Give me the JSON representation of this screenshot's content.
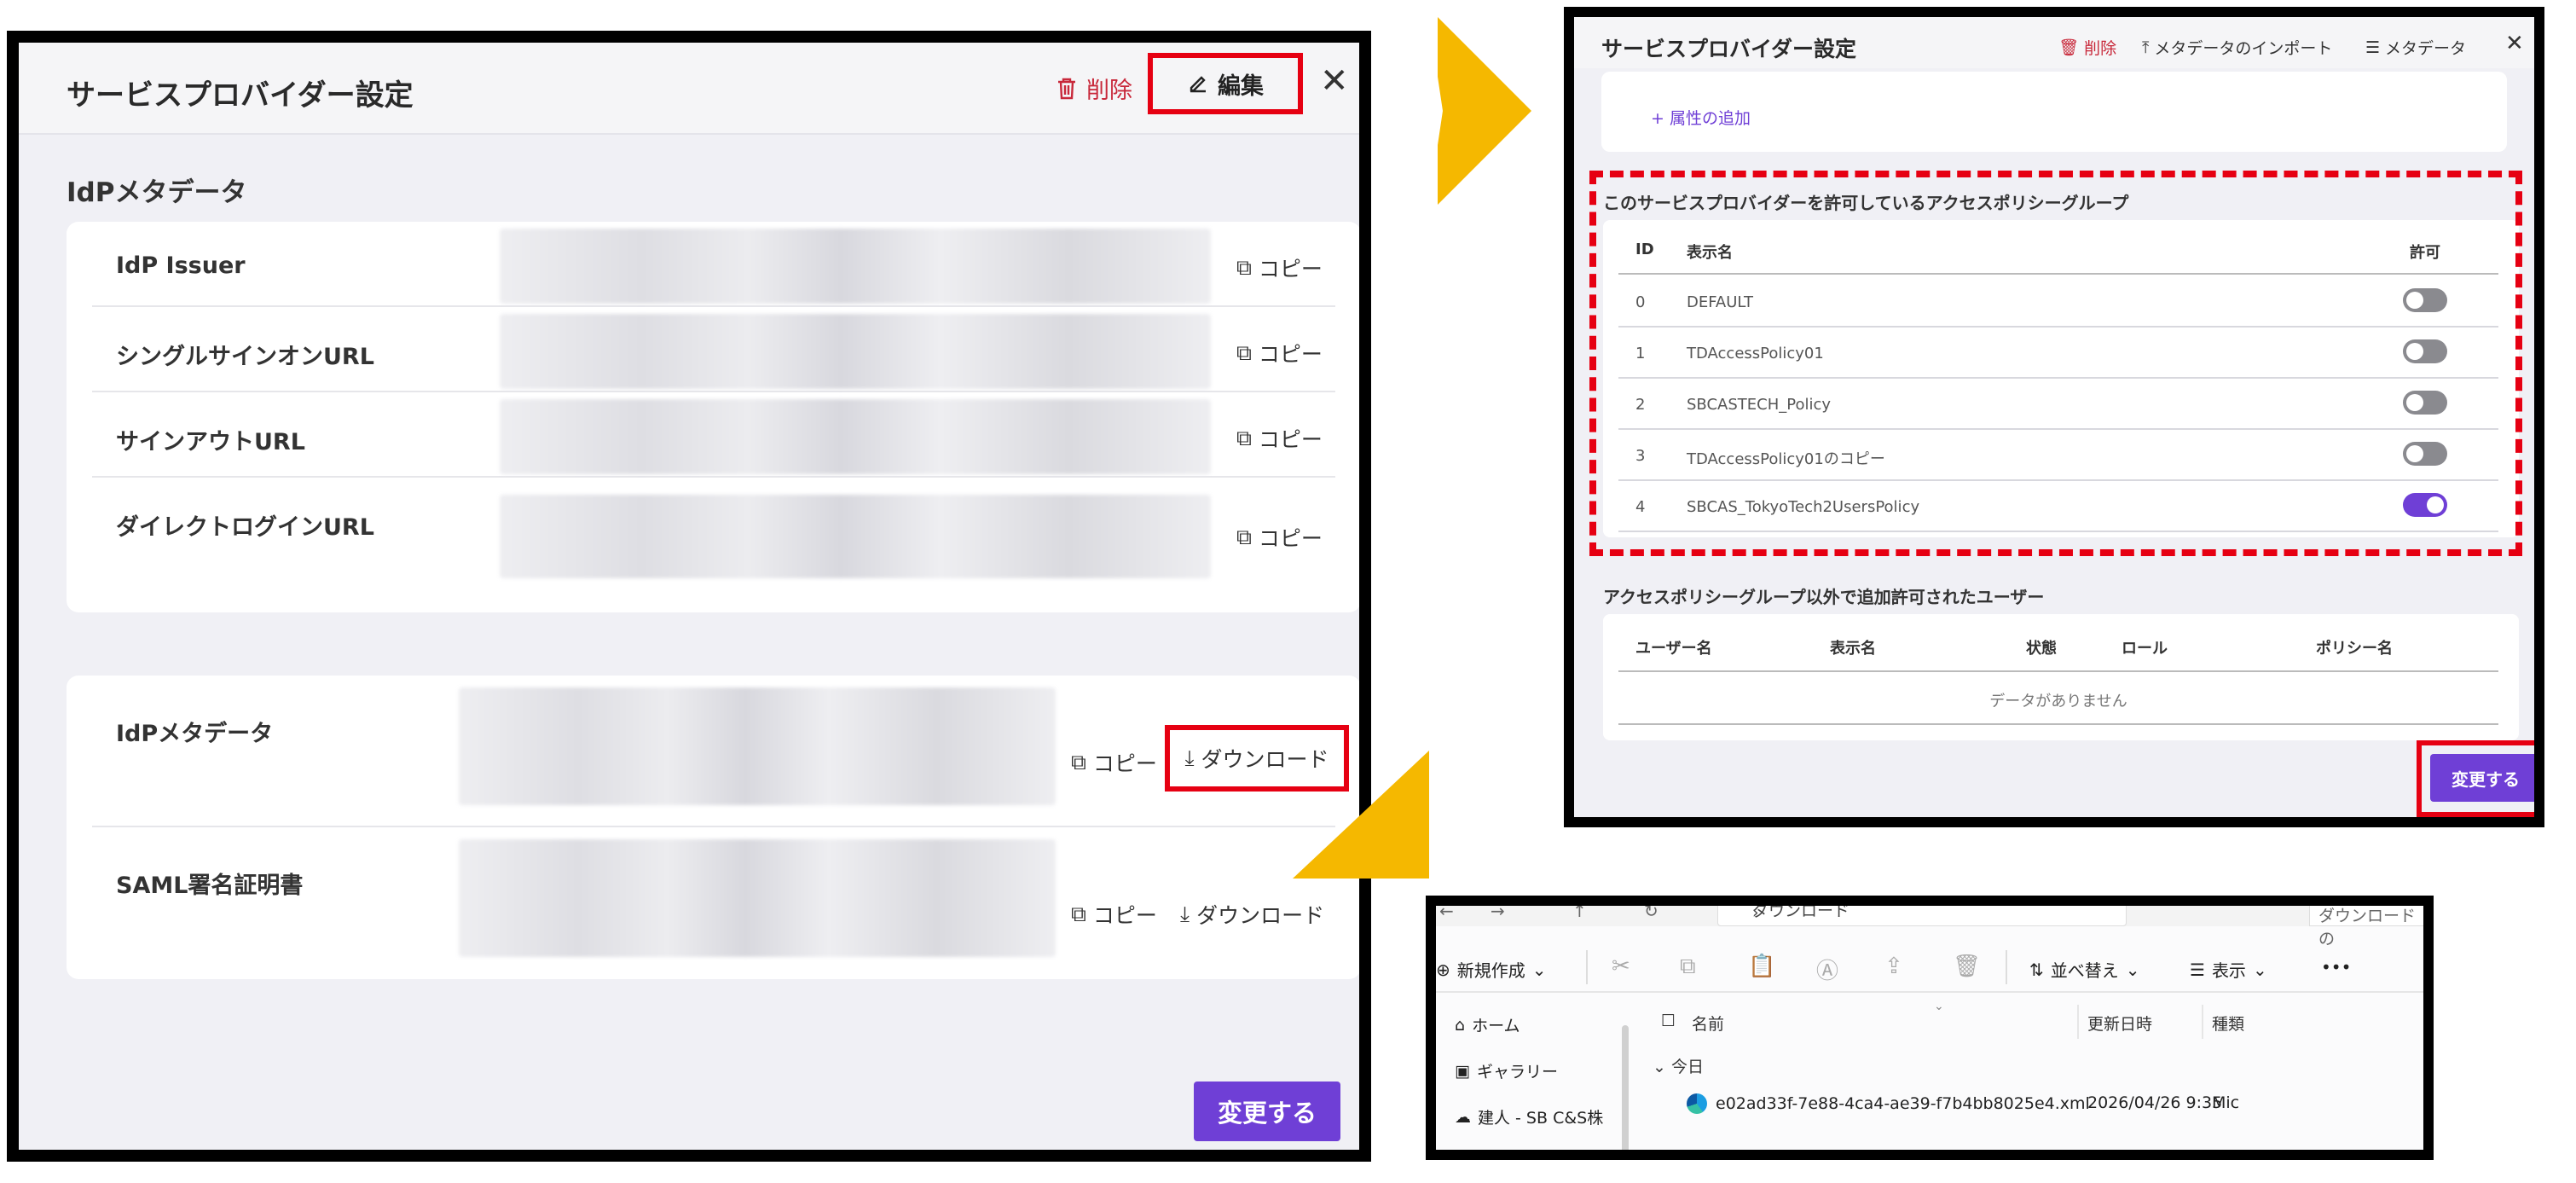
{
  "panel1": {
    "title": "サービスプロバイダー設定",
    "delete_label": "削除",
    "edit_label": "編集",
    "section_title": "IdPメタデータ",
    "info_rows": [
      {
        "label": "IdP Issuer",
        "copy": "コピー"
      },
      {
        "label": "シングルサインオンURL",
        "copy": "コピー"
      },
      {
        "label": "サインアウトURL",
        "copy": "コピー"
      },
      {
        "label": "ダイレクトログインURL",
        "copy": "コピー"
      }
    ],
    "file_rows": [
      {
        "label": "IdPメタデータ",
        "copy": "コピー",
        "download": "ダウンロード"
      },
      {
        "label": "SAML署名証明書",
        "copy": "コピー",
        "download": "ダウンロード"
      }
    ],
    "save_label": "変更する"
  },
  "panel2": {
    "title": "サービスプロバイダー設定",
    "delete_label": "削除",
    "import_label": "メタデータのインポート",
    "metadata_label": "メタデータ",
    "add_attribute": "属性の追加",
    "policy_section": "このサービスプロバイダーを許可しているアクセスポリシーグループ",
    "policy_headers": {
      "id": "ID",
      "name": "表示名",
      "allow": "許可"
    },
    "policies": [
      {
        "id": "0",
        "name": "DEFAULT",
        "allowed": false
      },
      {
        "id": "1",
        "name": "TDAccessPolicy01",
        "allowed": false
      },
      {
        "id": "2",
        "name": "SBCASTECH_Policy",
        "allowed": false
      },
      {
        "id": "3",
        "name": "TDAccessPolicy01のコピー",
        "allowed": false
      },
      {
        "id": "4",
        "name": "SBCAS_TokyoTech2UsersPolicy",
        "allowed": true
      }
    ],
    "users_section": "アクセスポリシーグループ以外で追加許可されたユーザー",
    "user_headers": {
      "username": "ユーザー名",
      "display_name": "表示名",
      "status": "状態",
      "role": "ロール",
      "policy": "ポリシー名"
    },
    "no_data": "データがありません",
    "save_label": "変更する"
  },
  "explorer": {
    "path": "ダウンロード",
    "search": "ダウンロードの",
    "new_label": "新規作成",
    "sort_label": "並べ替え",
    "view_label": "表示",
    "more_label": "•••",
    "sidebar": [
      {
        "label": "ホーム",
        "icon": "home-icon"
      },
      {
        "label": "ギャラリー",
        "icon": "gallery-icon"
      },
      {
        "label": "建人 - SB C&S株",
        "icon": "onedrive-icon"
      }
    ],
    "columns": {
      "name": "名前",
      "date": "更新日時",
      "type": "種類"
    },
    "group": "今日",
    "file": {
      "name": "e02ad33f-7e88-4ca4-ae39-f7b4bb8025e4.xml",
      "date": "2026/04/26 9:35",
      "type": "Mic"
    }
  },
  "colors": {
    "accent": "#6f3fd6",
    "highlight": "#e60012",
    "arrow": "#f5b800",
    "danger": "#c8283a"
  }
}
